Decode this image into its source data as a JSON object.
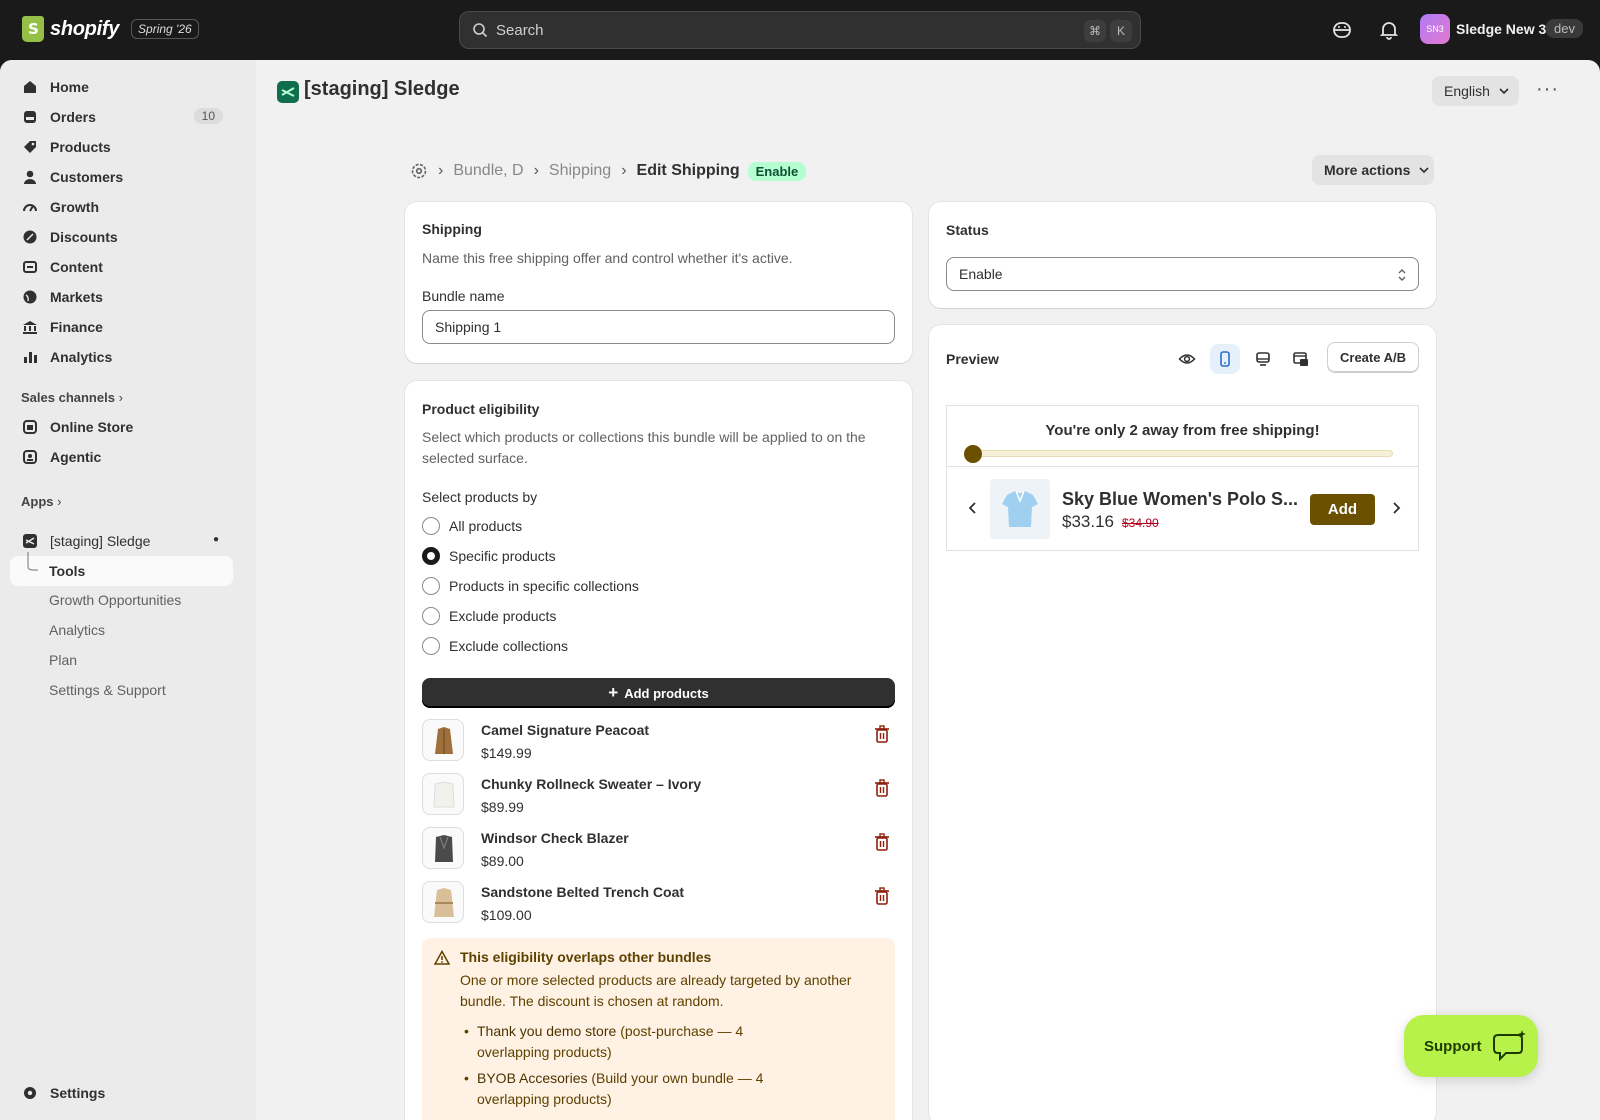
{
  "topbar": {
    "logo_text": "shopify",
    "logo_badge": "Spring '26",
    "search_placeholder": "Search",
    "shortcut_cmd": "⌘",
    "shortcut_key": "K",
    "avatar_initials": "SN3",
    "store_name": "Sledge New 3",
    "env_badge": "dev"
  },
  "sidebar": {
    "items": [
      {
        "label": "Home",
        "icon": "home-icon"
      },
      {
        "label": "Orders",
        "icon": "orders-icon",
        "count": "10"
      },
      {
        "label": "Products",
        "icon": "tag-icon"
      },
      {
        "label": "Customers",
        "icon": "person-icon"
      },
      {
        "label": "Growth",
        "icon": "gauge-icon"
      },
      {
        "label": "Discounts",
        "icon": "discount-icon"
      },
      {
        "label": "Content",
        "icon": "content-icon"
      },
      {
        "label": "Markets",
        "icon": "globe-icon"
      },
      {
        "label": "Finance",
        "icon": "bank-icon"
      },
      {
        "label": "Analytics",
        "icon": "bar-chart-icon"
      }
    ],
    "sales_channels_label": "Sales channels",
    "channels": [
      {
        "label": "Online Store",
        "icon": "store-icon"
      },
      {
        "label": "Agentic",
        "icon": "agentic-icon"
      }
    ],
    "apps_label": "Apps",
    "app_name": "[staging] Sledge",
    "app_sub": [
      "Tools",
      "Growth Opportunities",
      "Analytics",
      "Plan",
      "Settings & Support"
    ],
    "settings_label": "Settings"
  },
  "header": {
    "app_title": "[staging] Sledge",
    "language": "English"
  },
  "breadcrumb": {
    "items": [
      "Bundle, D",
      "Shipping"
    ],
    "current": "Edit Shipping",
    "badge": "Enable",
    "more_actions": "More actions"
  },
  "shipping_card": {
    "title": "Shipping",
    "description": "Name this free shipping offer and control whether it's active.",
    "bundle_name_label": "Bundle name",
    "bundle_name_value": "Shipping 1"
  },
  "eligibility_card": {
    "title": "Product eligibility",
    "description": "Select which products or collections this bundle will be applied to on the selected surface.",
    "select_by_label": "Select products by",
    "options": [
      "All products",
      "Specific products",
      "Products in specific collections",
      "Exclude products",
      "Exclude collections"
    ],
    "selected_option": "Specific products",
    "add_products_label": "Add products",
    "products": [
      {
        "name": "Camel Signature Peacoat",
        "price": "$149.99"
      },
      {
        "name": "Chunky Rollneck Sweater – Ivory",
        "price": "$89.99"
      },
      {
        "name": "Windsor Check Blazer",
        "price": "$89.00"
      },
      {
        "name": "Sandstone Belted Trench Coat",
        "price": "$109.00"
      }
    ],
    "warning": {
      "title": "This eligibility overlaps other bundles",
      "body": "One or more selected products are already targeted by another bundle. The discount is chosen at random.",
      "items": [
        {
          "name": "Thank you demo store",
          "detail": "(post-purchase — 4 overlapping products)"
        },
        {
          "name": "BYOB Accesories",
          "detail": "(Build your own bundle — 4 overlapping products)"
        }
      ]
    }
  },
  "status_card": {
    "title": "Status",
    "value": "Enable"
  },
  "preview_card": {
    "title": "Preview",
    "create_ab_label": "Create A/B",
    "message": "You're only 2 away from free shipping!",
    "progress": 0.02,
    "product_name": "Sky Blue Women's Polo S...",
    "product_price": "$33.16",
    "compare_price": "$34.90",
    "add_label": "Add"
  },
  "support": {
    "label": "Support"
  },
  "colors": {
    "accent_brown": "#6b5000",
    "support_green": "#b6f24a",
    "badge_green": "#b4fed2",
    "trash_red": "#8e1f0b"
  }
}
